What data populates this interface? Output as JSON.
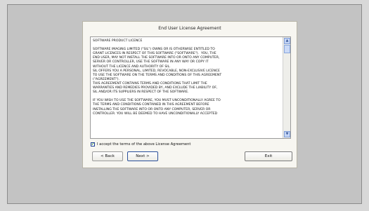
{
  "dialog": {
    "title": "End User License Agreement",
    "license_text": "SOFTWARE PRODUCT LICENCE\n\nSOFTWARE IMAGING LIMITED (\"SIL\") OWNS OR IS OTHERWISE ENTITLED TO\nGRANT LICENCES IN RESPECT OF THIS SOFTWARE (\"SOFTWARE\").  YOU, THE\nEND USER, MAY NOT INSTALL THE SOFTWARE INTO OR ONTO ANY COMPUTER,\nSERVER OR CONTROLLER, USE THE SOFTWARE IN ANY WAY OR COPY IT\nWITHOUT THE LICENCE AND AUTHORITY OF SIL.\nSIL OFFERS YOU A PERSONAL, LIMITED, REVOCABLE, NON-EXCLUSIVE LICENCE\nTO USE THE SOFTWARE ON THE TERMS AND CONDITIONS OF THIS AGREEMENT\n(\"AGREEMENT\").\nTHIS AGREEMENT CONTAINS TERMS AND CONDITIONS THAT LIMIT THE\nWARRANTIES AND REMEDIES PROVIDED BY, AND EXCLUDE THE LIABILITY OF,\nSIL AND/OR ITS SUPPLIERS IN RESPECT OF THE SOFTWARE.\n\nIF YOU WISH TO USE THE SOFTWARE, YOU MUST UNCONDITIONALLY AGREE TO\nTHE TERMS AND CONDITIONS CONTAINED IN THIS AGREEMENT BEFORE\nINSTALLING THE SOFTWARE INTO OR ONTO ANY COMPUTER, SERVER OR\nCONTROLLER. YOU WILL BE DEEMED TO HAVE UNCONDITIONALLY ACCEPTED",
    "accept_label": "I accept the terms of the above License Agreement",
    "accept_checked": true,
    "back_label": "< Back",
    "next_label": "Next >",
    "exit_label": "Exit"
  },
  "icons": {
    "scroll_up": "scroll-up-arrow",
    "scroll_down": "scroll-down-arrow",
    "checkmark": "checkmark"
  },
  "colors": {
    "dialog_bg": "#f7f6f1",
    "background": "#d8d8d8",
    "frame": "#c3c3c3",
    "scrollbar_accent": "#c5d6f6"
  }
}
